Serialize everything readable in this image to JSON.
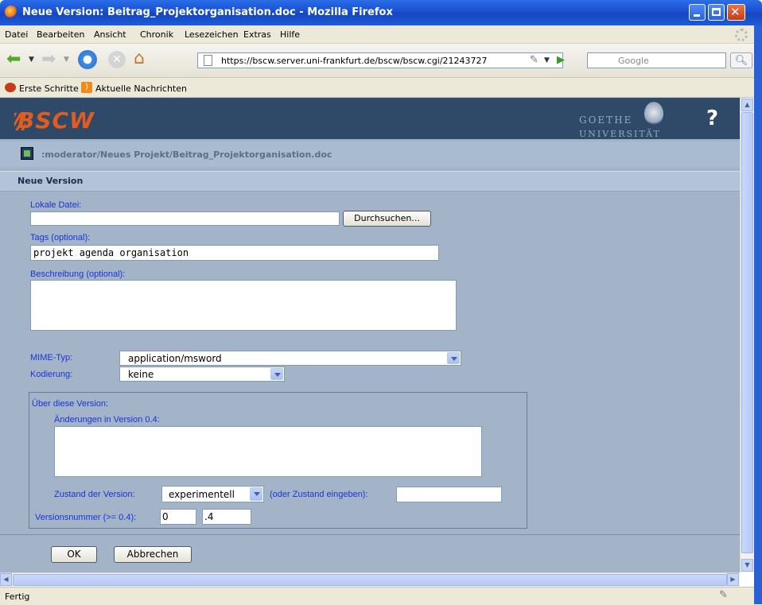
{
  "window": {
    "title": "Neue Version: Beitrag_Projektorganisation.doc - Mozilla Firefox"
  },
  "menubar": {
    "items": [
      "Datei",
      "Bearbeiten",
      "Ansicht",
      "Chronik",
      "Lesezeichen",
      "Extras",
      "Hilfe"
    ]
  },
  "navbar": {
    "url": "https://bscw.server.uni-frankfurt.de/bscw/bscw.cgi/21243727",
    "search_placeholder": "Google"
  },
  "bookmarks": {
    "items": [
      "Erste Schritte",
      "Aktuelle Nachrichten"
    ]
  },
  "header": {
    "logo": "BSCW",
    "university_line1": "GOETHE",
    "university_line2": "UNIVERSITÄT",
    "help": "?"
  },
  "path": ":moderator/Neues Projekt/Beitrag_Projektorganisation.doc",
  "form": {
    "title": "Neue Version",
    "local_file_label": "Lokale Datei:",
    "local_file_value": "",
    "browse_button": "Durchsuchen...",
    "tags_label": "Tags (optional):",
    "tags_value": "projekt agenda organisation",
    "description_label": "Beschreibung (optional):",
    "description_value": "",
    "mime_label": "MIME-Typ:",
    "mime_value": "application/msword",
    "encoding_label": "Kodierung:",
    "encoding_value": "keine",
    "version_box": {
      "legend": "Über diese Version:",
      "changes_label": "Änderungen in Version 0.4:",
      "changes_value": "",
      "state_label": "Zustand der Version:",
      "state_value": "experimentell",
      "state_hint": "(oder Zustand eingeben):",
      "state_custom_value": "",
      "number_label": "Versionsnummer (>= 0.4):",
      "number_major": "0",
      "number_minor": ".4"
    },
    "ok_button": "OK",
    "cancel_button": "Abbrechen"
  },
  "status": {
    "text": "Fertig"
  },
  "colors": {
    "label_blue": "#1a33d6",
    "header_navy": "#2f4a68",
    "content_bg": "#a3b4c9",
    "bscw_orange": "#e25b1f"
  }
}
